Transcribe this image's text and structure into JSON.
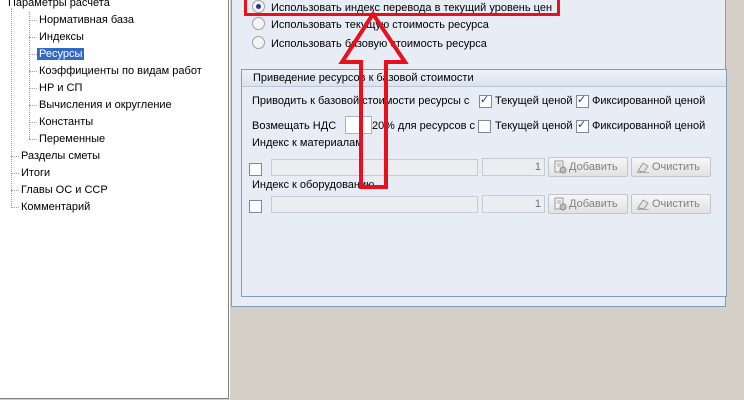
{
  "tree": {
    "items": [
      {
        "label": "Параметры расчета"
      },
      {
        "label": "Нормативная база"
      },
      {
        "label": "Индексы"
      },
      {
        "label": "Ресурсы"
      },
      {
        "label": "Коэффициенты по видам работ"
      },
      {
        "label": "НР и СП"
      },
      {
        "label": "Вычисления и округление"
      },
      {
        "label": "Константы"
      },
      {
        "label": "Переменные"
      },
      {
        "label": "Разделы сметы"
      },
      {
        "label": "Итоги"
      },
      {
        "label": "Главы ОС и ССР"
      },
      {
        "label": "Комментарий"
      }
    ],
    "selected": "Ресурсы"
  },
  "options": {
    "use_index": "Использовать индекс перевода в текущий уровень цен",
    "use_current": "Использовать текущую стоимость ресурса",
    "use_base": "Использовать базовую стоимость ресурса",
    "selected": "use_index"
  },
  "group": {
    "title": "Приведение ресурсов к базовой стоимости",
    "convert_label": "Приводить к базовой стоимости ресурсы с",
    "current_price": "Текущей ценой",
    "fixed_price": "Фиксированной ценой",
    "vat_label": "Возмещать НДС",
    "vat_value": "",
    "vat_percent": "20",
    "vat_suffix": "% для ресурсов с",
    "materials_label": "Индекс к материалам",
    "materials_count": "1",
    "equipment_label": "Индекс к оборудованию",
    "equipment_count": "1",
    "add_label": "Добавить",
    "clear_label": "Очистить"
  },
  "colors": {
    "highlight": "#e8101c",
    "selection": "#316ac5",
    "frame": "#7f9db9"
  }
}
